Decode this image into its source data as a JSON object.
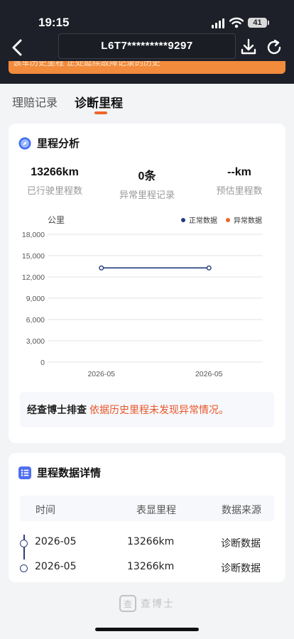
{
  "status_bar": {
    "time": "19:15",
    "battery": "41"
  },
  "nav": {
    "vin": "L6T7*********9297",
    "back_icon": "chevron-left-icon",
    "download_icon": "download-icon",
    "refresh_icon": "refresh-icon"
  },
  "notice": {
    "text": "该车历史里程 正处延续故障记录的历史"
  },
  "tabs": [
    {
      "label": "理赔记录",
      "active": false
    },
    {
      "label": "诊断里程",
      "active": true
    }
  ],
  "mileage_analysis": {
    "title": "里程分析",
    "stats": [
      {
        "value": "13266km",
        "label": "已行驶里程数"
      },
      {
        "value": "0条",
        "label": "异常里程记录"
      },
      {
        "value": "--km",
        "label": "预估里程数"
      }
    ]
  },
  "chart_data": {
    "type": "line",
    "ylabel": "公里",
    "categories": [
      "2026-05",
      "2026-05"
    ],
    "series": [
      {
        "name": "正常数据",
        "color": "#1f3a7a",
        "values": [
          13266,
          13266
        ]
      },
      {
        "name": "异常数据",
        "color": "#f06429",
        "values": []
      }
    ],
    "yticks": [
      "0",
      "3,000",
      "6,000",
      "9,000",
      "12,000",
      "15,000",
      "18,000"
    ],
    "ylim": [
      0,
      18000
    ],
    "grid": true,
    "legend": "top-right"
  },
  "diagnosis": {
    "label": "经查博士排查",
    "text": "依据历史里程未发现异常情况。"
  },
  "details": {
    "title": "里程数据详情",
    "columns": [
      "时间",
      "表显里程",
      "数据来源"
    ],
    "rows": [
      {
        "time": "2026-05",
        "mileage": "13266km",
        "source": "诊断数据"
      },
      {
        "time": "2026-05",
        "mileage": "13266km",
        "source": "诊断数据"
      }
    ]
  },
  "footer": {
    "logo_text": "查博士",
    "logo_glyph": "查"
  },
  "colors": {
    "accent": "#f06429",
    "header_bg": "#1e2029",
    "normal_series": "#1f3a7a"
  }
}
